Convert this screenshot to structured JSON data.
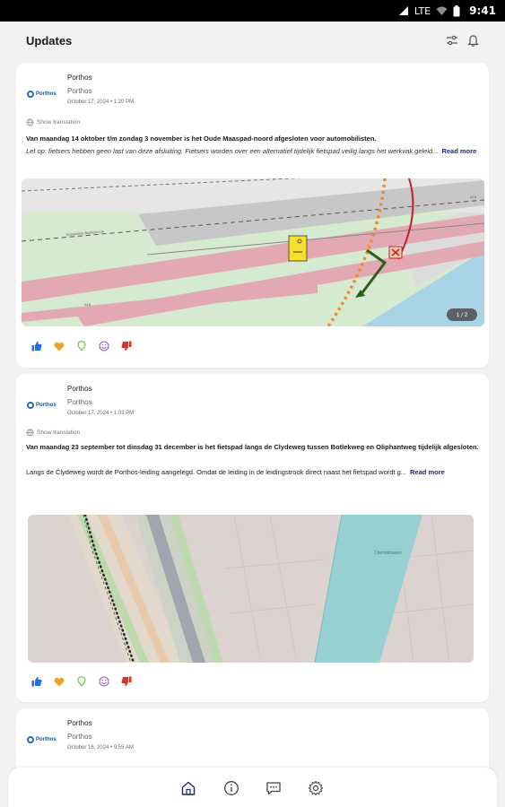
{
  "status_bar": {
    "network": "LTE",
    "time": "9:41"
  },
  "header": {
    "title": "Updates",
    "filter_icon": "sliders-icon",
    "bell_icon": "bell-icon"
  },
  "posts": [
    {
      "author": "Porthos",
      "org": "Porthos",
      "logo_text": "Porthos",
      "date": "October 17, 2024 • 1:20 PM",
      "translate": "Show translation",
      "text_bold": "Van maandag 14 oktober t/m zondag 3 november is het Oude Maaspad-noord afgesloten voor automobilisten.",
      "text_italic": "Let op: fietsers hebben geen last van deze afsluiting. Fietsers worden over een alternatief tijdelijk fietspad veilig langs het werkvak geleid...",
      "read_more": "Read more",
      "image_counter": "1 / 2",
      "map_labels": [
        "Aansluiting Boekenrode",
        "A15",
        "A15"
      ]
    },
    {
      "author": "Porthos",
      "org": "Porthos",
      "logo_text": "Porthos",
      "date": "October 17, 2024 • 1:03 PM",
      "translate": "Show translation",
      "text_bold": "Van maandag 23 september tot dinsdag 31 december is het fietspad langs de Clydeweg tussen Botlekweg en Oliphantweg tijdelijk afgesloten.",
      "text_plain": "Langs de Clydeweg wordt de Porthos-leiding aangelegd. Omdat de leiding in de leidingstrook direct naast het fietspad wordt g...",
      "read_more": "Read more",
      "map_labels": [
        "Chemiehaven"
      ]
    },
    {
      "author": "Porthos",
      "org": "Porthos",
      "logo_text": "Porthos",
      "date": "October 16, 2024 • 9:55 AM"
    }
  ],
  "reactions": [
    "thumbs-up-icon",
    "heart-icon",
    "lightbulb-icon",
    "smile-icon",
    "thumbs-down-icon"
  ],
  "reaction_colors": [
    "#1f6fe5",
    "#f0a12c",
    "#6cc04a",
    "#9b59d0",
    "#d9342b"
  ],
  "bottom_nav": [
    "home-icon",
    "info-icon",
    "chat-icon",
    "settings-icon"
  ]
}
